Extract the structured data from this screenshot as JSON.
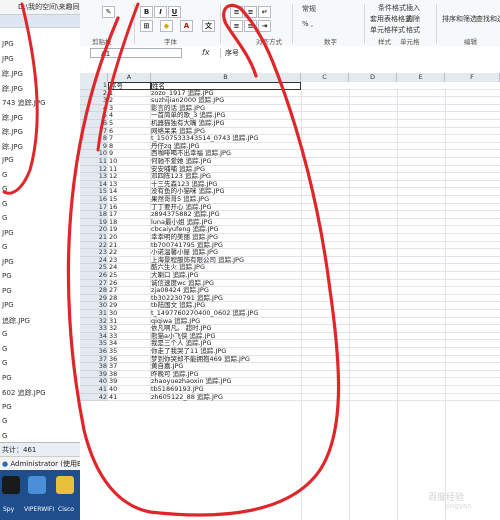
{
  "left_panel": {
    "path": "D:\\我的空间\\来趣同络",
    "files": [
      {
        "text": "JPG"
      },
      {
        "text": "JPG"
      },
      {
        "text": "踪.JPG"
      },
      {
        "text": "踪.JPG"
      },
      {
        "text": "743  追踪.JPG"
      },
      {
        "text": "踪.JPG"
      },
      {
        "text": "踪.JPG"
      },
      {
        "text": "踪.JPG"
      },
      {
        "text": "JPG"
      },
      {
        "text": "G"
      },
      {
        "text": "G"
      },
      {
        "text": "G"
      },
      {
        "text": "G"
      },
      {
        "text": "JPG"
      },
      {
        "text": "G"
      },
      {
        "text": "JPG"
      },
      {
        "text": "PG"
      },
      {
        "text": "PG"
      },
      {
        "text": "JPG"
      },
      {
        "text": "追踪.JPG"
      },
      {
        "text": "G"
      },
      {
        "text": "G"
      },
      {
        "text": "G"
      },
      {
        "text": "PG"
      },
      {
        "text": "602  追踪.JPG"
      },
      {
        "text": "PG"
      },
      {
        "text": "G"
      },
      {
        "text": "G"
      }
    ],
    "status": "  共计：461",
    "user": "Administrator (使用B)",
    "taskbar": [
      {
        "label": "Spy",
        "color": "#1a1a1a"
      },
      {
        "label": "VIPERWIFI",
        "color": "#4a8fd8"
      },
      {
        "label": "Cisco",
        "color": "#e8c13a"
      }
    ]
  },
  "ribbon": {
    "font_group": "字体",
    "align_group": "对齐方式",
    "number_group": "数字",
    "styles_group": "样式",
    "cells_group": "单元格",
    "edit_group": "编辑",
    "bold": "B",
    "italic": "I",
    "underline": "U",
    "number_format": "常规",
    "percent": "% ,",
    "conditional_format": "条件格式",
    "table_format": "套用表格格式",
    "cell_style": "单元格样式",
    "insert": "插入",
    "delete": "删除",
    "format": "格式",
    "sort_filter": "排序和筛选",
    "find_select": "查找和选择",
    "clipboard_group": "剪贴板"
  },
  "formula_bar": {
    "name_box": "A1",
    "fx": "fx",
    "value": "序号"
  },
  "grid": {
    "columns": [
      "A",
      "B",
      "C",
      "D",
      "E",
      "F"
    ],
    "header": {
      "a": "序号",
      "b": "姓名"
    },
    "rows": [
      {
        "n": "2",
        "a": "1",
        "b": "zozo_1917  追踪.JPG"
      },
      {
        "n": "3",
        "a": "2",
        "b": "suzhijian2000  追踪.JPG"
      },
      {
        "n": "4",
        "a": "3",
        "b": "影言的话  追踪.JPG"
      },
      {
        "n": "5",
        "a": "4",
        "b": "一首简单的歌_3  追踪.JPG"
      },
      {
        "n": "6",
        "a": "5",
        "b": "机器猫独有大嘴  追踪.JPG"
      },
      {
        "n": "7",
        "a": "6",
        "b": "网络呆呆  追踪.JPG"
      },
      {
        "n": "8",
        "a": "7",
        "b": "t_1507533343514_0743  追踪.JPG"
      },
      {
        "n": "9",
        "a": "8",
        "b": "丹仔zq  追踪.JPG"
      },
      {
        "n": "10",
        "a": "9",
        "b": "西咖啡喝不出幸福  追踪.JPG"
      },
      {
        "n": "11",
        "a": "10",
        "b": "何驰不爱她  追踪.JPG"
      },
      {
        "n": "12",
        "a": "11",
        "b": "安安哺哺  追踪.JPG"
      },
      {
        "n": "13",
        "a": "12",
        "b": "邓四陈123  追踪.JPG"
      },
      {
        "n": "14",
        "a": "13",
        "b": "十三先森123  追踪.JPG"
      },
      {
        "n": "15",
        "a": "14",
        "b": "没有鱼的小猫咪  追踪.JPG"
      },
      {
        "n": "16",
        "a": "15",
        "b": "果然哥哥5  追踪.JPG"
      },
      {
        "n": "17",
        "a": "16",
        "b": "丁丁要开心  追踪.JPG"
      },
      {
        "n": "18",
        "a": "17",
        "b": "z894375882  追踪.JPG"
      },
      {
        "n": "19",
        "a": "18",
        "b": "luna最小姐  追踪.JPG"
      },
      {
        "n": "20",
        "a": "19",
        "b": "cbcaiyufeng  追踪.JPG"
      },
      {
        "n": "21",
        "a": "20",
        "b": "幸幸明的美丽  追踪.JPG"
      },
      {
        "n": "22",
        "a": "21",
        "b": "tb700741795  追踪.JPG"
      },
      {
        "n": "23",
        "a": "22",
        "b": "小诺温馨小屋  追踪.JPG"
      },
      {
        "n": "24",
        "a": "23",
        "b": "上海景程服饰有限公司  追踪.JPG"
      },
      {
        "n": "25",
        "a": "24",
        "b": "酷六生火  追踪.JPG"
      },
      {
        "n": "26",
        "a": "25",
        "b": "大喇口  追踪.JPG"
      },
      {
        "n": "27",
        "a": "26",
        "b": "诚信速度wc  追踪.JPG"
      },
      {
        "n": "28",
        "a": "27",
        "b": "zja08424  追踪.JPG"
      },
      {
        "n": "29",
        "a": "28",
        "b": "tb302230791  追踪.JPG"
      },
      {
        "n": "30",
        "a": "29",
        "b": "tb陆国文  追踪.JPG"
      },
      {
        "n": "31",
        "a": "30",
        "b": "t_1497760270400_0602  追踪.JPG"
      },
      {
        "n": "32",
        "a": "31",
        "b": "qiqiwa  追踪.JPG"
      },
      {
        "n": "33",
        "a": "32",
        "b": "依凡啊凡。  超时.JPG"
      },
      {
        "n": "34",
        "a": "33",
        "b": "熊猫a小飞侠  追踪.JPG"
      },
      {
        "n": "35",
        "a": "34",
        "b": "我是三个人  追踪.JPG"
      },
      {
        "n": "36",
        "a": "35",
        "b": "你走了我哭了11  追踪.JPG"
      },
      {
        "n": "37",
        "a": "36",
        "b": "梦到你哭却不能拥抱469  追踪.JPG"
      },
      {
        "n": "38",
        "a": "37",
        "b": "黄自嘉.JPG"
      },
      {
        "n": "39",
        "a": "38",
        "b": "昨晚可  追踪.JPG"
      },
      {
        "n": "40",
        "a": "39",
        "b": "zhaoyuezhaoxin  追踪.JPG"
      },
      {
        "n": "41",
        "a": "40",
        "b": "tb51869193.JPG"
      },
      {
        "n": "42",
        "a": "41",
        "b": "zh605122_88  追踪.JPG"
      }
    ]
  },
  "watermark": {
    "line1": "百度经验",
    "line2": "jingyan"
  },
  "colors": {
    "annotation": "#e0262a",
    "header_fill": "#e4e9f0",
    "taskbar": "#1f4e8c"
  }
}
